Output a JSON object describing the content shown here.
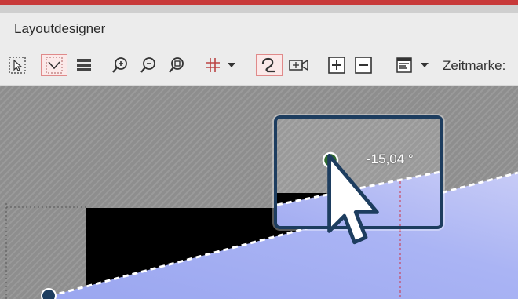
{
  "window": {
    "title": "Layoutdesigner"
  },
  "toolbar": {
    "zeitmarke_label": "Zeitmarke:"
  },
  "editor": {
    "angle_readout": "-15,04 °"
  },
  "colors": {
    "accent_red": "#c83a3a",
    "magnifier_border": "#1d3d5f",
    "image_blue": "#aab4f4"
  }
}
